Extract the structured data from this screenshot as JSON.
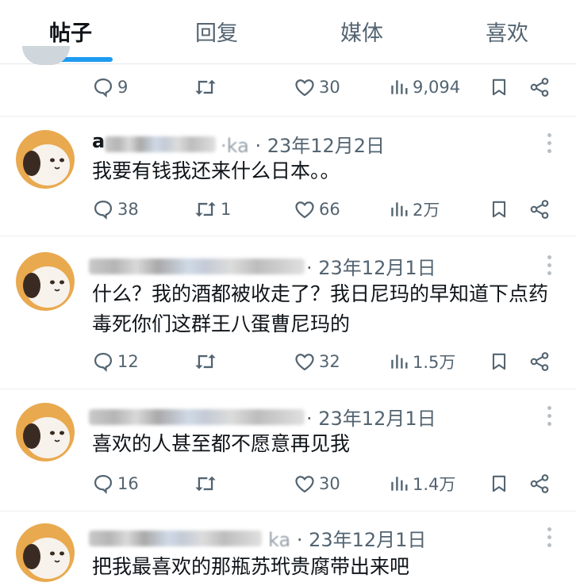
{
  "tabs": [
    "帖子",
    "回复",
    "媒体",
    "喜欢"
  ],
  "active_tab": "帖子",
  "colors": {
    "accent": "#1d9bf0",
    "text": "#0f1419",
    "muted": "#536471"
  },
  "top_stats": {
    "replies": "9",
    "retweets": "",
    "likes": "30",
    "views": "9,094"
  },
  "posts": [
    {
      "name_lead": "a",
      "handle_tail": "·ka",
      "date": "· 23年12月2日",
      "text": "我要有钱我还来什么日本。。",
      "replies": "38",
      "retweets": "1",
      "likes": "66",
      "views": "2万"
    },
    {
      "name_lead": "",
      "handle_tail": "",
      "date": "· 23年12月1日",
      "text": "什么？我的酒都被收走了？我日尼玛的早知道下点药毒死你们这群王八蛋曹尼玛的",
      "replies": "12",
      "retweets": "",
      "likes": "32",
      "views": "1.5万"
    },
    {
      "name_lead": "",
      "handle_tail": "",
      "date": "· 23年12月1日",
      "text": "喜欢的人甚至都不愿意再见我",
      "replies": "16",
      "retweets": "",
      "likes": "30",
      "views": "1.4万"
    },
    {
      "name_lead": "",
      "handle_tail": "ka",
      "date": "· 23年12月1日",
      "text": "把我最喜欢的那瓶苏玳贵腐带出来吧"
    }
  ]
}
